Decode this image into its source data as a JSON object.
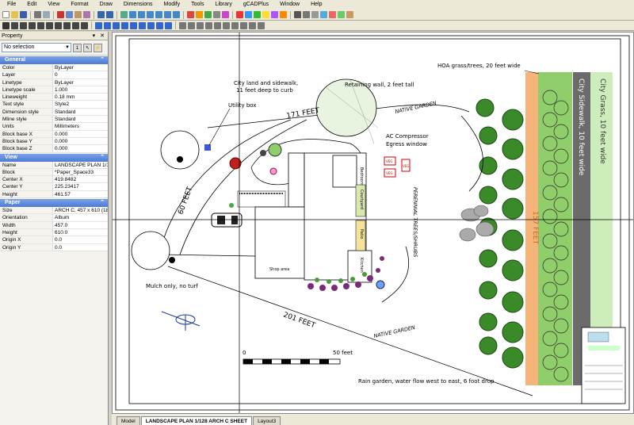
{
  "menu": [
    "File",
    "Edit",
    "View",
    "Format",
    "Draw",
    "Dimensions",
    "Modify",
    "Tools",
    "Library",
    "gCADPlus",
    "Window",
    "Help"
  ],
  "panel": {
    "title": "Property",
    "controls": "▾ ✕",
    "selection": "No selection",
    "sections": {
      "general": "General",
      "view": "View",
      "paper": "Paper"
    },
    "general_rows": [
      {
        "k": "Color",
        "v": "ByLayer"
      },
      {
        "k": "Layer",
        "v": "0"
      },
      {
        "k": "Linetype",
        "v": "ByLayer"
      },
      {
        "k": "Linetype scale",
        "v": "1.000"
      },
      {
        "k": "Lineweight",
        "v": "0.18 mm"
      },
      {
        "k": "Text style",
        "v": "Style2"
      },
      {
        "k": "Dimension style",
        "v": "Standard"
      },
      {
        "k": "Mline style",
        "v": "Standard"
      },
      {
        "k": "Units",
        "v": "Millimeters"
      },
      {
        "k": "Block base X",
        "v": "0.000"
      },
      {
        "k": "Block base Y",
        "v": "0.000"
      },
      {
        "k": "Block base Z",
        "v": "0.000"
      }
    ],
    "view_rows": [
      {
        "k": "Name",
        "v": "LANDSCAPE PLAN 1/1"
      },
      {
        "k": "Block",
        "v": "*Paper_Space33"
      },
      {
        "k": "Center X",
        "v": "419.8482"
      },
      {
        "k": "Center Y",
        "v": "225.23417"
      },
      {
        "k": "Height",
        "v": "461.57"
      }
    ],
    "paper_rows": [
      {
        "k": "Size",
        "v": "ARCH C, 457 x 610 (18"
      },
      {
        "k": "Orientation",
        "v": "Album"
      },
      {
        "k": "Width",
        "v": "457.0"
      },
      {
        "k": "Height",
        "v": "610.0"
      },
      {
        "k": "Origin X",
        "v": "0.0"
      },
      {
        "k": "Origin Y",
        "v": "0.0"
      }
    ]
  },
  "drawing": {
    "hoa": "HOA grass/trees, 20 feet wide",
    "city_land": "City land and sidewalk,",
    "city_land2": "11 feet deep to curb",
    "utility": "Utility box",
    "retaining": "Retaining wall, 2 feet tall",
    "native1": "NATIVE GARDEN",
    "native2": "NATIVE GARDEN",
    "compressor": "AC Compressor",
    "egress": "Egress window",
    "f171": "171 FEET",
    "f60": "60 FEET",
    "f201": "201 FEET",
    "f157": "157 FEET",
    "perennial": "PERENNIAL TREES/SHRUBS",
    "mulch": "Mulch only, no turf",
    "rain": "Rain garden, water flow west to east, 6 foot drop",
    "scale0": "0",
    "scale50": "50 feet",
    "city_grass": "City Grass, 10 feet wide",
    "city_sidewalk": "City Sidewalk, 10 feet wide",
    "bedroom": "Bedroom",
    "courtyard": "Courtyard",
    "patio": "Patio",
    "garage": "Shop area",
    "kitchen": "Kitchen",
    "veg1": "VEG",
    "veg2": "VEG",
    "veg3": "VEG"
  },
  "tabs": [
    "Model",
    "LANDSCAPE PLAN 1/128 ARCH C SHEET",
    "Layout3"
  ]
}
